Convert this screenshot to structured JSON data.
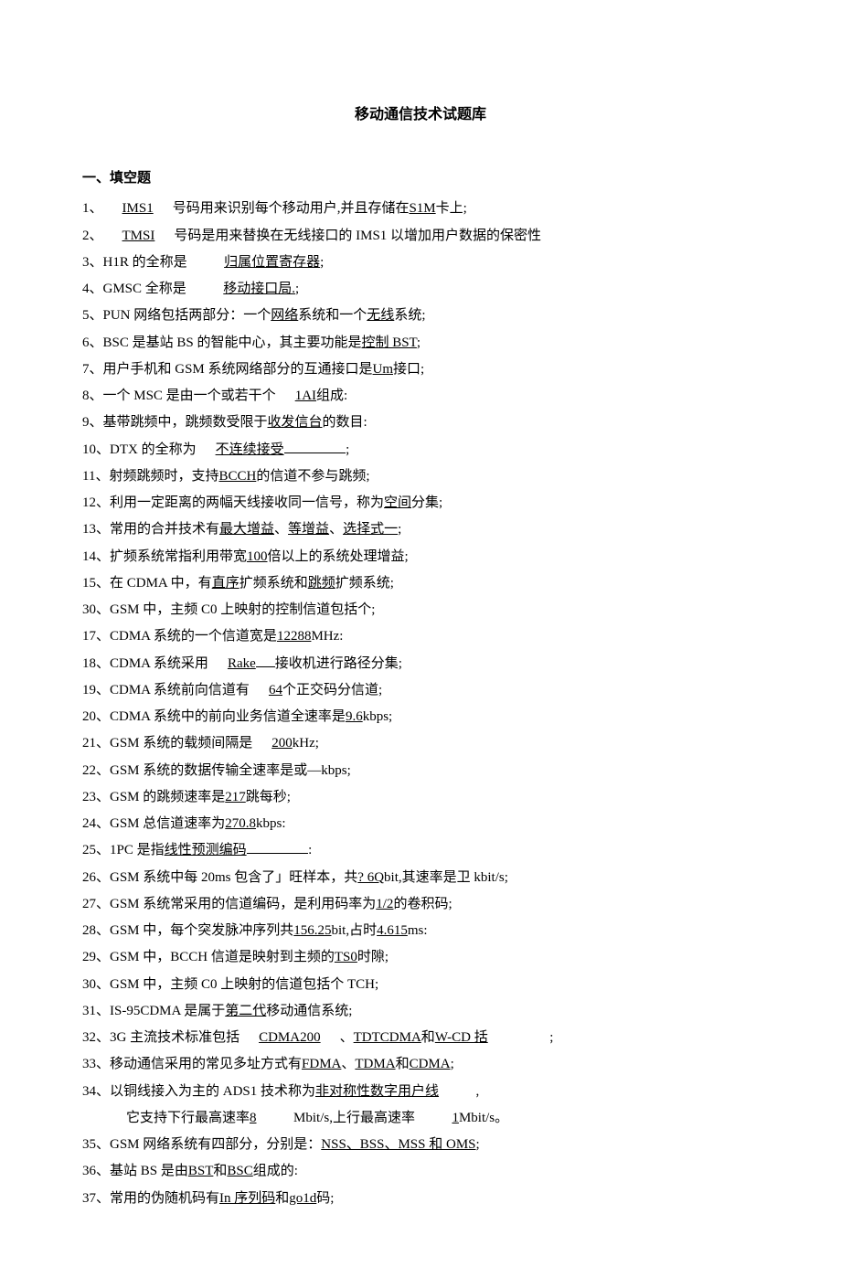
{
  "title": "移动通信技术试题库",
  "section1_head": "一、填空题",
  "q": {
    "1": {
      "n": "1、",
      "a": "IMS1",
      "b": "号码用来识别每个移动用户,并且存储在",
      "c": "S1M",
      "d": "卡上;"
    },
    "2": {
      "n": "2、",
      "a": "TMSI",
      "b": "号码是用来替换在无线接口的 IMS1 以增加用户数据的保密性"
    },
    "3": {
      "n": "3、H1R 的全称是",
      "a": "归属位置寄存器",
      "b": ";"
    },
    "4": {
      "n": "4、GMSC 全称是",
      "a": "移动接口局.",
      "b": ";"
    },
    "5": {
      "n": "5、PUN 网络包括两部分：一个",
      "a": "网络",
      "b": "系统和一个",
      "c": "无线",
      "d": "系统;"
    },
    "6": {
      "n": "6、BSC 是基站 BS 的智能中心，其主要功能是",
      "a": "控制 BST",
      "b": ";"
    },
    "7": {
      "n": "7、用户手机和 GSM 系统网络部分的互通接口是",
      "a": "Um",
      "b": "接口;"
    },
    "8": {
      "n": "8、一个 MSC 是由一个或若干个",
      "a": "1AI",
      "b": "组成:"
    },
    "9": {
      "n": "9、基带跳频中，跳频数受限于",
      "a": "收发信台",
      "b": "的数目:"
    },
    "10": {
      "n": "10、DTX 的全称为",
      "a": "不连续接受",
      "b": ";"
    },
    "11": {
      "n": "11、射频跳频时，支持",
      "a": "BCCH",
      "b": "的信道不参与跳频;"
    },
    "12": {
      "n": "12、利用一定距离的两幅天线接收同一信号，称为",
      "a": "空间",
      "b": "分集;"
    },
    "13": {
      "n": "13、常用的合并技术有",
      "a": "最大增益",
      "b": "、",
      "c": "等增益",
      "d": "、",
      "e": "选择式一",
      "f": ";"
    },
    "14": {
      "n": "14、扩频系统常指利用带宽",
      "a": "100",
      "b": "倍以上的系统处理增益;"
    },
    "15": {
      "n": "15、在 CDMA 中，有",
      "a": "直序",
      "b": "扩频系统和",
      "c": "跳频",
      "d": "扩频系统;"
    },
    "30a": {
      "n": "30、GSM 中，主频 C0 上映射的控制信道包括个;"
    },
    "17": {
      "n": "17、CDMA 系统的一个信道宽是",
      "a": "12288",
      "b": "MHz:"
    },
    "18": {
      "n": "18、CDMA 系统采用",
      "a": "Rake",
      "b": "接收机进行路径分集;"
    },
    "19": {
      "n": "19、CDMA 系统前向信道有",
      "a": "64",
      "b": "个正交码分信道;"
    },
    "20": {
      "n": "20、CDMA 系统中的前向业务信道全速率是",
      "a": "9.6",
      "b": "kbps;"
    },
    "21": {
      "n": "21、GSM 系统的载频间隔是",
      "a": "200",
      "b": "kHz;"
    },
    "22": {
      "n": "22、GSM 系统的数据传输全速率是或—kbps;"
    },
    "23": {
      "n": "23、GSM 的跳频速率是",
      "a": "217",
      "b": "跳每秒;"
    },
    "24": {
      "n": "24、GSM 总信道速率为",
      "a": "270.8",
      "b": "kbps:"
    },
    "25": {
      "n": "25、1PC 是指",
      "a": "线性预测编码",
      "b": ":"
    },
    "26": {
      "n": "26、GSM 系统中每 20ms 包含了」旺样本，共",
      "a": "? 6Q",
      "b": "bit,其速率是卫 kbit/s;"
    },
    "27": {
      "n": "27、GSM 系统常采用的信道编码，是利用码率为",
      "a": "1/2",
      "b": "的卷积码;"
    },
    "28": {
      "n": "28、GSM 中，每个突发脉冲序列共",
      "a": "156.25",
      "b": "bit,占时",
      "c": "4.615",
      "d": "ms:"
    },
    "29": {
      "n": "29、GSM 中，BCCH 信道是映射到主频的",
      "a": "TS0",
      "b": "时隙;"
    },
    "30b": {
      "n": "30、GSM 中，主频 C0 上映射的信道包括个 TCH;"
    },
    "31": {
      "n": "31、IS-95CDMA 是属于",
      "a": "第二代",
      "b": "移动通信系统;"
    },
    "32": {
      "n": "32、3G 主流技术标准包括",
      "a": "CDMA200",
      "b": "、",
      "c": "TDTCDMA",
      "d": "和",
      "e": "W-CD 括",
      "f": ";"
    },
    "33": {
      "n": "33、移动通信采用的常见多址方式有",
      "a": "FDMA",
      "b": "、",
      "c": "TDMA",
      "d": "和",
      "e": "CDMA",
      "f": ";"
    },
    "34": {
      "n": "34、以铜线接入为主的 ADS1 技术称为",
      "a": "非对称性数字用户线",
      "b": ","
    },
    "34c": {
      "pre": "它支持下行最高速率",
      "a": "8",
      "mid": "Mbit/s,上行最高速率",
      "c": "1",
      "end": "Mbit/s。"
    },
    "35": {
      "n": "35、GSM 网络系统有四部分，分别是：",
      "a": "NSS、BSS、MSS 和 OMS",
      "b": ";"
    },
    "36": {
      "n": "36、基站 BS 是由",
      "a": "BST",
      "b": "和",
      "c": "BSC",
      "d": "组成的:"
    },
    "37": {
      "n": "37、常用的伪随机码有",
      "a": "In 序列码",
      "b": "和",
      "c": "go1d",
      "d": "码;"
    }
  }
}
